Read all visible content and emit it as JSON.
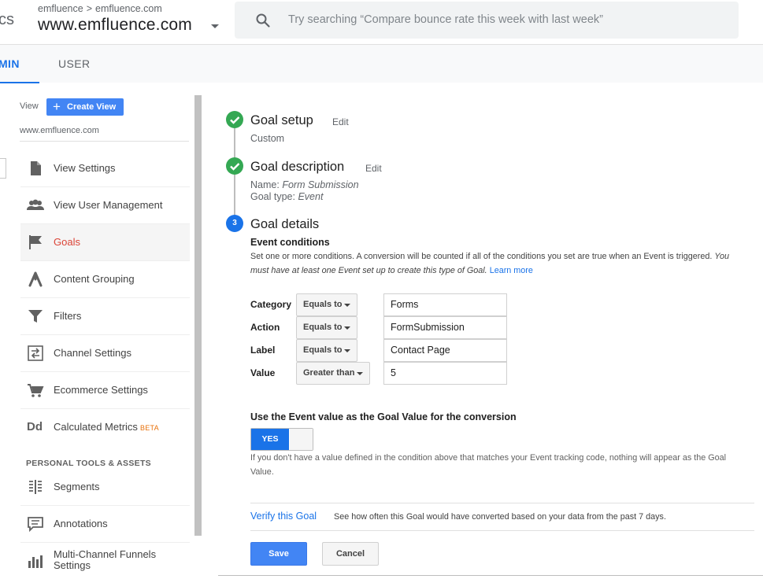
{
  "header": {
    "app_name_fragment": "cs",
    "breadcrumb": [
      "emfluence",
      "emfluence.com"
    ],
    "breadcrumb_separator": ">",
    "property_title": "www.emfluence.com",
    "search_placeholder": "Try searching “Compare bounce rate this week with last week”"
  },
  "tabs": [
    {
      "label": "MIN",
      "active": true
    },
    {
      "label": "USER",
      "active": false
    }
  ],
  "sidebar": {
    "view_label": "View",
    "create_view_label": "Create View",
    "view_url": "www.emfluence.com",
    "items": [
      {
        "label": "View Settings",
        "icon": "document-icon"
      },
      {
        "label": "View User Management",
        "icon": "people-icon"
      },
      {
        "label": "Goals",
        "icon": "flag-icon",
        "active": true
      },
      {
        "label": "Content Grouping",
        "icon": "content-grouping-icon"
      },
      {
        "label": "Filters",
        "icon": "filter-icon"
      },
      {
        "label": "Channel Settings",
        "icon": "channel-icon"
      },
      {
        "label": "Ecommerce Settings",
        "icon": "cart-icon"
      },
      {
        "label": "Calculated Metrics",
        "badge": "BETA",
        "icon": "dd-icon"
      }
    ],
    "section_header": "PERSONAL TOOLS & ASSETS",
    "tools": [
      {
        "label": "Segments",
        "icon": "segments-icon"
      },
      {
        "label": "Annotations",
        "icon": "annotation-icon"
      },
      {
        "label_line1": "Multi-Channel Funnels",
        "label_line2": "Settings",
        "icon": "bar-chart-icon"
      }
    ]
  },
  "steps": {
    "setup": {
      "title": "Goal setup",
      "edit": "Edit",
      "sub": "Custom"
    },
    "description": {
      "title": "Goal description",
      "edit": "Edit",
      "name_label": "Name:",
      "name_value": "Form Submission",
      "type_label": "Goal type:",
      "type_value": "Event"
    },
    "details": {
      "number": "3",
      "title": "Goal details"
    }
  },
  "event_conditions": {
    "title": "Event conditions",
    "desc_normal": "Set one or more conditions. A conversion will be counted if all of the conditions you set are true when an Event is triggered. ",
    "desc_italic": "You must have at least one Event set up to create this type of Goal.",
    "learn_more": "Learn more",
    "rows": [
      {
        "label": "Category",
        "operator": "Equals to",
        "value": "Forms"
      },
      {
        "label": "Action",
        "operator": "Equals to",
        "value": "FormSubmission"
      },
      {
        "label": "Label",
        "operator": "Equals to",
        "value": "Contact Page"
      },
      {
        "label": "Value",
        "operator": "Greater than",
        "value": "5"
      }
    ]
  },
  "goal_value": {
    "title": "Use the Event value as the Goal Value for the conversion",
    "toggle_label": "YES",
    "toggle_on": true,
    "help": "If you don't have a value defined in the condition above that matches your Event tracking code, nothing will appear as the Goal Value."
  },
  "verify": {
    "link": "Verify this Goal",
    "desc": "See how often this Goal would have converted based on your data from the past 7 days."
  },
  "actions": {
    "save": "Save",
    "cancel": "Cancel"
  },
  "colors": {
    "accent": "#1a73e8",
    "active_nav": "#db4437",
    "check": "#34a853",
    "beta": "#e8710a"
  }
}
